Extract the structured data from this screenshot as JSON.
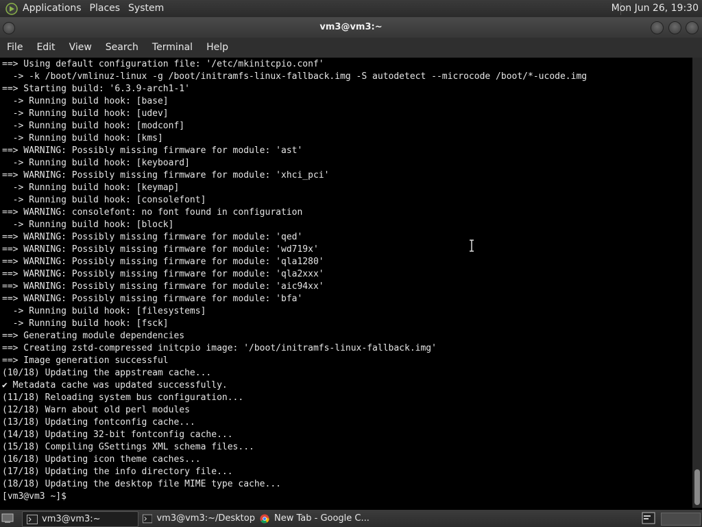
{
  "top_panel": {
    "menus": [
      "Applications",
      "Places",
      "System"
    ],
    "clock": "Mon Jun 26, 19:30"
  },
  "window": {
    "title": "vm3@vm3:~",
    "menu": [
      "File",
      "Edit",
      "View",
      "Search",
      "Terminal",
      "Help"
    ]
  },
  "terminal": {
    "lines": [
      "==> Using default configuration file: '/etc/mkinitcpio.conf'",
      "  -> -k /boot/vmlinuz-linux -g /boot/initramfs-linux-fallback.img -S autodetect --microcode /boot/*-ucode.img",
      "==> Starting build: '6.3.9-arch1-1'",
      "  -> Running build hook: [base]",
      "  -> Running build hook: [udev]",
      "  -> Running build hook: [modconf]",
      "  -> Running build hook: [kms]",
      "==> WARNING: Possibly missing firmware for module: 'ast'",
      "  -> Running build hook: [keyboard]",
      "==> WARNING: Possibly missing firmware for module: 'xhci_pci'",
      "  -> Running build hook: [keymap]",
      "  -> Running build hook: [consolefont]",
      "==> WARNING: consolefont: no font found in configuration",
      "  -> Running build hook: [block]",
      "==> WARNING: Possibly missing firmware for module: 'qed'",
      "==> WARNING: Possibly missing firmware for module: 'wd719x'",
      "==> WARNING: Possibly missing firmware for module: 'qla1280'",
      "==> WARNING: Possibly missing firmware for module: 'qla2xxx'",
      "==> WARNING: Possibly missing firmware for module: 'aic94xx'",
      "==> WARNING: Possibly missing firmware for module: 'bfa'",
      "  -> Running build hook: [filesystems]",
      "  -> Running build hook: [fsck]",
      "==> Generating module dependencies",
      "==> Creating zstd-compressed initcpio image: '/boot/initramfs-linux-fallback.img'",
      "==> Image generation successful",
      "(10/18) Updating the appstream cache...",
      "✔ Metadata cache was updated successfully.",
      "(11/18) Reloading system bus configuration...",
      "(12/18) Warn about old perl modules",
      "(13/18) Updating fontconfig cache...",
      "(14/18) Updating 32-bit fontconfig cache...",
      "(15/18) Compiling GSettings XML schema files...",
      "(16/18) Updating icon theme caches...",
      "(17/18) Updating the info directory file...",
      "(18/18) Updating the desktop file MIME type cache...",
      "[vm3@vm3 ~]$ "
    ]
  },
  "taskbar": {
    "tasks": [
      {
        "label": "vm3@vm3:~",
        "icon": "terminal-icon",
        "active": true
      },
      {
        "label": "vm3@vm3:~/Desktop",
        "icon": "terminal-icon",
        "active": false
      },
      {
        "label": "New Tab - Google C...",
        "icon": "chrome-icon",
        "active": false
      }
    ]
  }
}
